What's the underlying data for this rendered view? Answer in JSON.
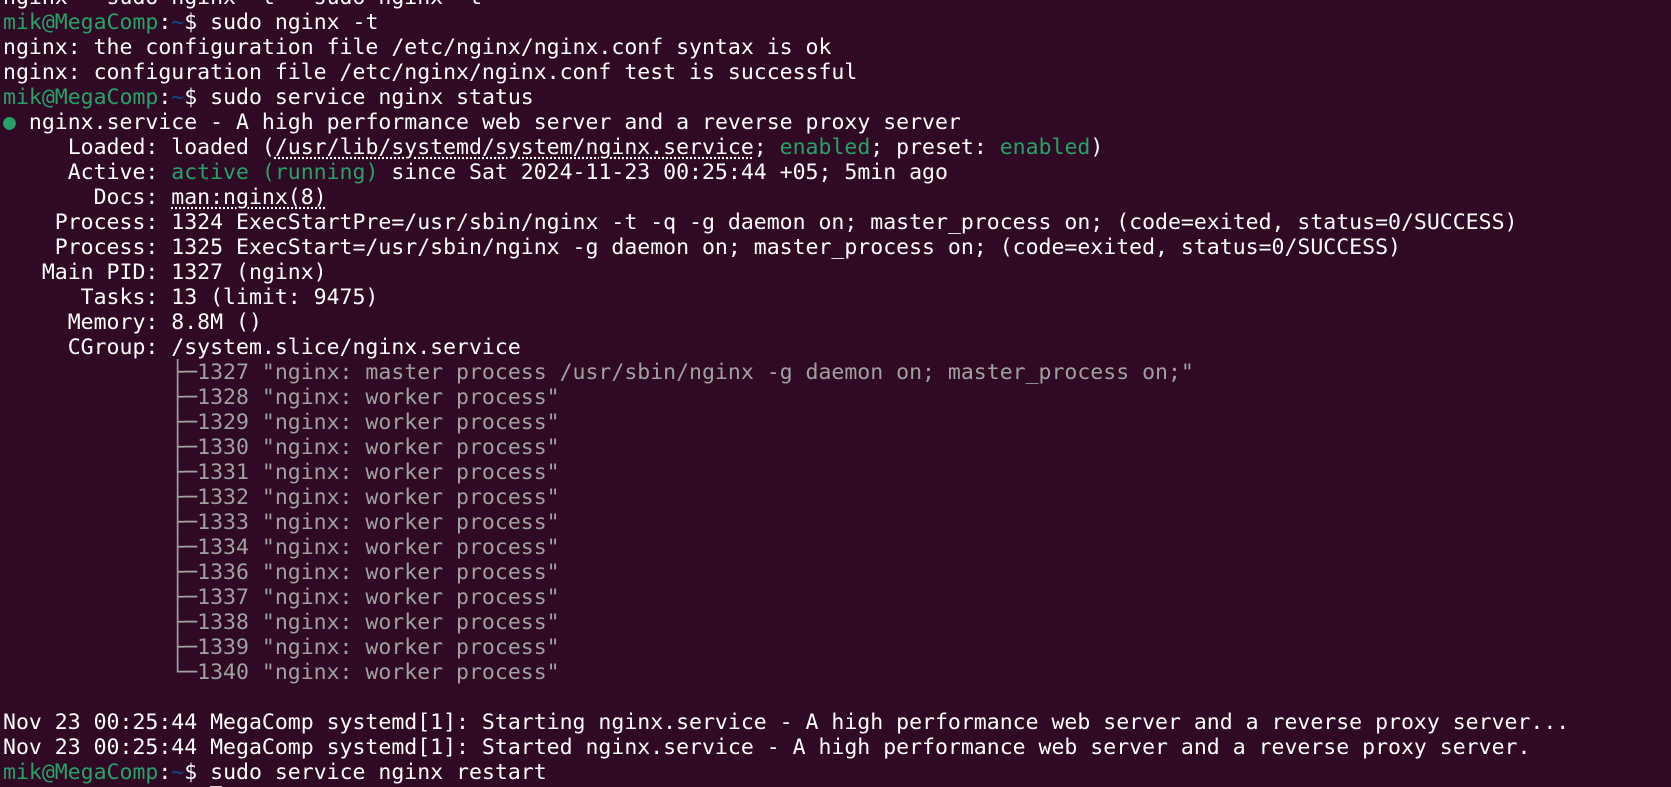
{
  "prompt": {
    "user_host": "mik@MegaComp",
    "sep": ":",
    "path": "~",
    "symbol": "$ "
  },
  "commands": {
    "test": "sudo nginx -t",
    "status": "sudo service nginx status",
    "restart": "sudo service nginx restart"
  },
  "top_partial": "nginx   sudo nginx -t   sudo nginx -t",
  "test_output": [
    "nginx: the configuration file /etc/nginx/nginx.conf syntax is ok",
    "nginx: configuration file /etc/nginx/nginx.conf test is successful"
  ],
  "status": {
    "bullet": "●",
    "unit_line": "nginx.service - A high performance web server and a reverse proxy server",
    "loaded": {
      "label": "     Loaded: ",
      "prefix": "loaded (",
      "path": "/usr/lib/systemd/system/nginx.service",
      "sep1": "; ",
      "state": "enabled",
      "sep2": "; preset: ",
      "preset": "enabled",
      "suffix": ")"
    },
    "active": {
      "label": "     Active: ",
      "state": "active (running)",
      "since": " since Sat 2024-11-23 00:25:44 +05; 5min ago"
    },
    "docs": {
      "label": "       Docs: ",
      "value": "man:nginx(8)"
    },
    "process1": "    Process: 1324 ExecStartPre=/usr/sbin/nginx -t -q -g daemon on; master_process on; (code=exited, status=0/SUCCESS)",
    "process2": "    Process: 1325 ExecStart=/usr/sbin/nginx -g daemon on; master_process on; (code=exited, status=0/SUCCESS)",
    "main_pid": "   Main PID: 1327 (nginx)",
    "tasks": "      Tasks: 13 (limit: 9475)",
    "memory": "     Memory: 8.8M ()",
    "cgroup": "     CGroup: /system.slice/nginx.service",
    "tree": [
      "             ├─1327 \"nginx: master process /usr/sbin/nginx -g daemon on; master_process on;\"",
      "             ├─1328 \"nginx: worker process\"",
      "             ├─1329 \"nginx: worker process\"",
      "             ├─1330 \"nginx: worker process\"",
      "             ├─1331 \"nginx: worker process\"",
      "             ├─1332 \"nginx: worker process\"",
      "             ├─1333 \"nginx: worker process\"",
      "             ├─1334 \"nginx: worker process\"",
      "             ├─1336 \"nginx: worker process\"",
      "             ├─1337 \"nginx: worker process\"",
      "             ├─1338 \"nginx: worker process\"",
      "             ├─1339 \"nginx: worker process\"",
      "             └─1340 \"nginx: worker process\""
    ]
  },
  "journal": [
    "Nov 23 00:25:44 MegaComp systemd[1]: Starting nginx.service - A high performance web server and a reverse proxy server...",
    "Nov 23 00:25:44 MegaComp systemd[1]: Started nginx.service - A high performance web server and a reverse proxy server."
  ],
  "colors": {
    "background": "#300a24",
    "prompt_user": "#26a269",
    "prompt_path": "#12488b",
    "accent_green": "#26a269",
    "dim_text": "#a0a0a0"
  }
}
